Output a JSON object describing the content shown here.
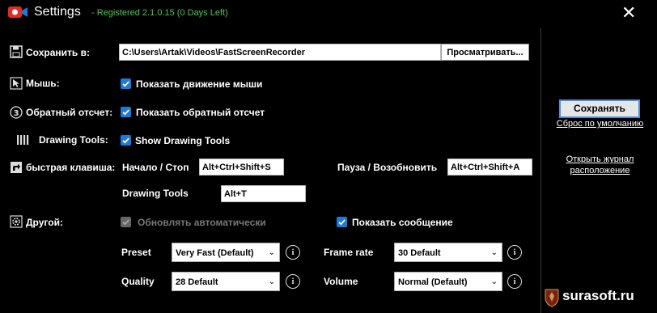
{
  "window": {
    "title": "Settings",
    "registration": "- Registered 2.1.0.15 (0 Days Left)",
    "close_glyph": "✕"
  },
  "save_to": {
    "label": "Сохранить в:",
    "path": "C:\\Users\\Artak\\Videos\\FastScreenRecorder",
    "browse_label": "Просматривать..."
  },
  "mouse": {
    "label": "Мышь:",
    "show_movement_label": "Показать движение мыши",
    "show_movement_checked": true
  },
  "countdown": {
    "label": "Обратный отсчет:",
    "show_countdown_label": "Показать обратный отсчет",
    "show_countdown_checked": true
  },
  "drawing_tools": {
    "label": "Drawing Tools:",
    "show_label": "Show Drawing Tools",
    "show_checked": true
  },
  "hotkeys": {
    "label": "быстрая клавиша:",
    "start_stop_label": "Начало / Стоп",
    "start_stop_value": "Alt+Ctrl+Shift+S",
    "pause_resume_label": "Пауза / Возобновить",
    "pause_resume_value": "Alt+Ctrl+Shift+A",
    "drawing_tools_label": "Drawing Tools",
    "drawing_tools_value": "Alt+T"
  },
  "other": {
    "label": "Другой:",
    "auto_update_label": "Обновлять автоматически",
    "auto_update_checked": true,
    "auto_update_enabled": false,
    "show_message_label": "Показать сообщение",
    "show_message_checked": true,
    "preset_label": "Preset",
    "preset_value": "Very Fast (Default)",
    "frame_rate_label": "Frame rate",
    "frame_rate_value": "30 Default",
    "quality_label": "Quality",
    "quality_value": "28 Default",
    "volume_label": "Volume",
    "volume_value": "Normal (Default)",
    "info_glyph": "i",
    "dropdown_glyph": "⌄"
  },
  "sidebar": {
    "save_label": "Сохранять",
    "reset_label": "Сброс по умолчанию",
    "open_log_label": "Открыть журнал расположение"
  },
  "watermark": {
    "text": "surasoft.ru"
  },
  "colors": {
    "background": "#000000",
    "accent": "#1e7ad6",
    "registration": "#4cc64c"
  }
}
